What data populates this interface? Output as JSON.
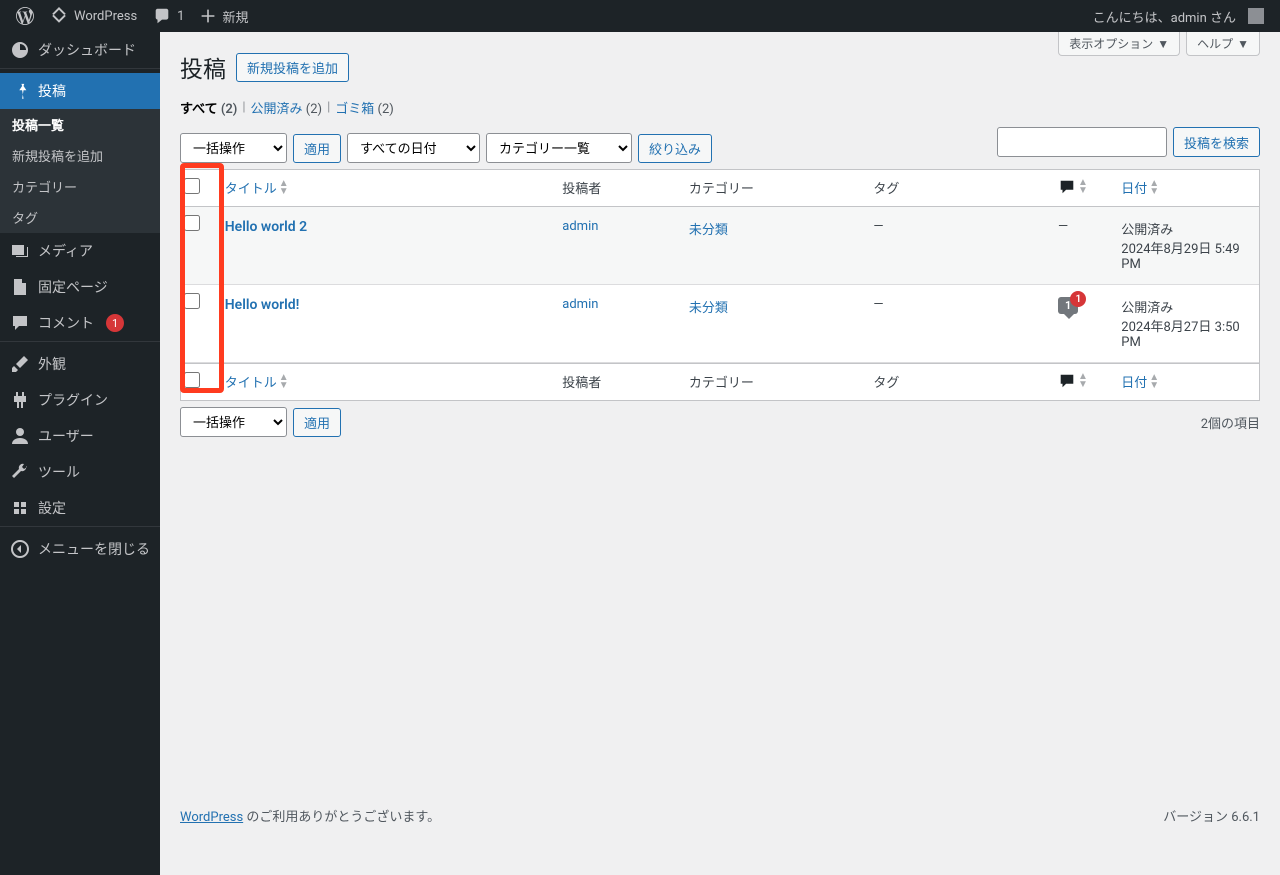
{
  "adminbar": {
    "site_name": "WordPress",
    "comment_count": "1",
    "new_label": "新規",
    "greeting": "こんにちは、admin さん"
  },
  "sidebar": {
    "dashboard": "ダッシュボード",
    "posts": "投稿",
    "posts_sub": {
      "list": "投稿一覧",
      "add": "新規投稿を追加",
      "cat": "カテゴリー",
      "tag": "タグ"
    },
    "media": "メディア",
    "pages": "固定ページ",
    "comments": "コメント",
    "comments_badge": "1",
    "appearance": "外観",
    "plugins": "プラグイン",
    "users": "ユーザー",
    "tools": "ツール",
    "settings": "設定",
    "collapse": "メニューを閉じる"
  },
  "topright": {
    "screen_options": "表示オプション",
    "help": "ヘルプ"
  },
  "page": {
    "title": "投稿",
    "add_new": "新規投稿を追加",
    "filters": {
      "all_label": "すべて",
      "all_count": "(2)",
      "published_label": "公開済み",
      "published_count": "(2)",
      "trash_label": "ゴミ箱",
      "trash_count": "(2)"
    },
    "search_btn": "投稿を検索",
    "bulk": "一括操作",
    "apply": "適用",
    "date_filter": "すべての日付",
    "cat_filter": "カテゴリー一覧",
    "filter_btn": "絞り込み",
    "items_count": "2個の項目"
  },
  "columns": {
    "title": "タイトル",
    "author": "投稿者",
    "categories": "カテゴリー",
    "tags": "タグ",
    "date": "日付"
  },
  "rows": [
    {
      "title": "Hello world 2",
      "author": "admin",
      "categories": "未分類",
      "tags": "—",
      "comments": "—",
      "status": "公開済み",
      "date": "2024年8月29日 5:49 PM"
    },
    {
      "title": "Hello world!",
      "author": "admin",
      "categories": "未分類",
      "tags": "—",
      "comment_count": "1",
      "pending_count": "1",
      "status": "公開済み",
      "date": "2024年8月27日 3:50 PM"
    }
  ],
  "footer": {
    "thanks_pre": "WordPress",
    "thanks_post": " のご利用ありがとうございます。",
    "version": "バージョン 6.6.1"
  }
}
